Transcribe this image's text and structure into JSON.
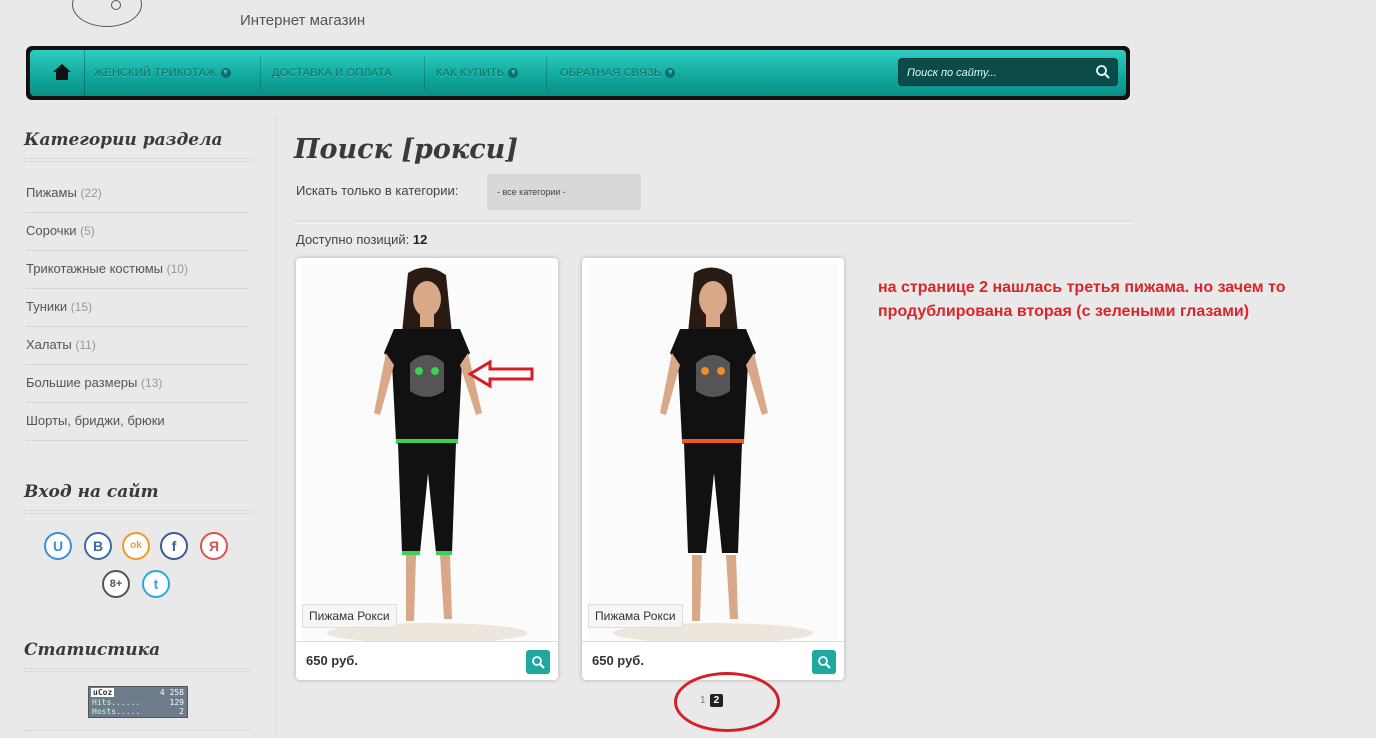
{
  "header": {
    "subtitle": "Интернет магазин"
  },
  "nav": {
    "items": [
      {
        "label": "Женский трикотаж",
        "has_menu": true
      },
      {
        "label": "Доставка и оплата",
        "has_menu": false
      },
      {
        "label": "Как купить",
        "has_menu": true
      },
      {
        "label": "Обратная связь",
        "has_menu": true
      }
    ],
    "search_placeholder": "Поиск по сайту..."
  },
  "sidebar": {
    "categories_title": "Категории раздела",
    "categories": [
      {
        "name": "Пижамы",
        "count": "(22)"
      },
      {
        "name": "Сорочки",
        "count": "(5)"
      },
      {
        "name": "Трикотажные костюмы",
        "count": "(10)"
      },
      {
        "name": "Туники",
        "count": "(15)"
      },
      {
        "name": "Халаты",
        "count": "(11)"
      },
      {
        "name": "Большие размеры",
        "count": "(13)"
      },
      {
        "name": "Шорты, бриджи, брюки",
        "count": ""
      }
    ],
    "login_title": "Вход на сайт",
    "social": [
      "U",
      "B",
      "ok",
      "f",
      "Я",
      "8+",
      "t"
    ],
    "stats_title": "Статистика",
    "counter": {
      "brand": "uCoz",
      "total": "4 258",
      "hits_label": "Hits......",
      "hits": "129",
      "hosts_label": "Hosts.....",
      "hosts": "2"
    }
  },
  "main": {
    "title": "Поиск [рокси]",
    "filter_label": "Искать только в категории:",
    "filter_value": "- все категории -",
    "available_label": "Доступно позиций:",
    "available_count": "12",
    "products": [
      {
        "name": "Пижама Рокси",
        "price": "650 руб.",
        "eye_color": "#3ad24e",
        "trim_color": "#3ad24e"
      },
      {
        "name": "Пижама Рокси",
        "price": "650 руб.",
        "eye_color": "#f08a2a",
        "trim_color": "#f05a1e"
      }
    ],
    "pagination": {
      "pages": [
        "1",
        "2"
      ],
      "current": "2"
    }
  },
  "annotation": "на странице 2 нашлась третья пижама. но зачем то продублирована вторая (с зелеными глазами)",
  "colors": {
    "nav": "#10a79c",
    "annotation": "#d9252b"
  }
}
